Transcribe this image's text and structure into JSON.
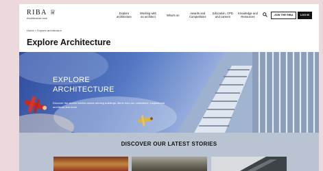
{
  "header": {
    "logo_line1": "RIBA",
    "logo_mark": "♕",
    "logo_line2": "Architecture.com",
    "nav": [
      {
        "l1": "Explore",
        "l2": "architecture"
      },
      {
        "l1": "Working with",
        "l2": "an architect"
      },
      {
        "l1": "What's on",
        "l2": ""
      },
      {
        "l1": "Awards and",
        "l2": "Competitions"
      },
      {
        "l1": "Education, CPD",
        "l2": "and careers"
      },
      {
        "l1": "Knowledge and",
        "l2": "Resources"
      }
    ],
    "search_icon": "search-icon",
    "join_label": "JOIN THE RIBA",
    "login_label": "LOG IN"
  },
  "breadcrumb": {
    "home": "Home",
    "sep": ">",
    "current": "Explore architecture"
  },
  "page_title": "Explore Architecture",
  "hero": {
    "title_line1": "EXPLORE",
    "title_line2": "ARCHITECTURE",
    "description": "Discover the stories behind award winning buildings, items from our collections, inspirational architects and more"
  },
  "stories": {
    "title": "DISCOVER OUR LATEST STORIES"
  },
  "colors": {
    "accent_dark": "#111111",
    "hero_blue": "#2e4a9c",
    "stories_bg": "#b9c3d1",
    "page_bg": "#ecd9dc"
  }
}
